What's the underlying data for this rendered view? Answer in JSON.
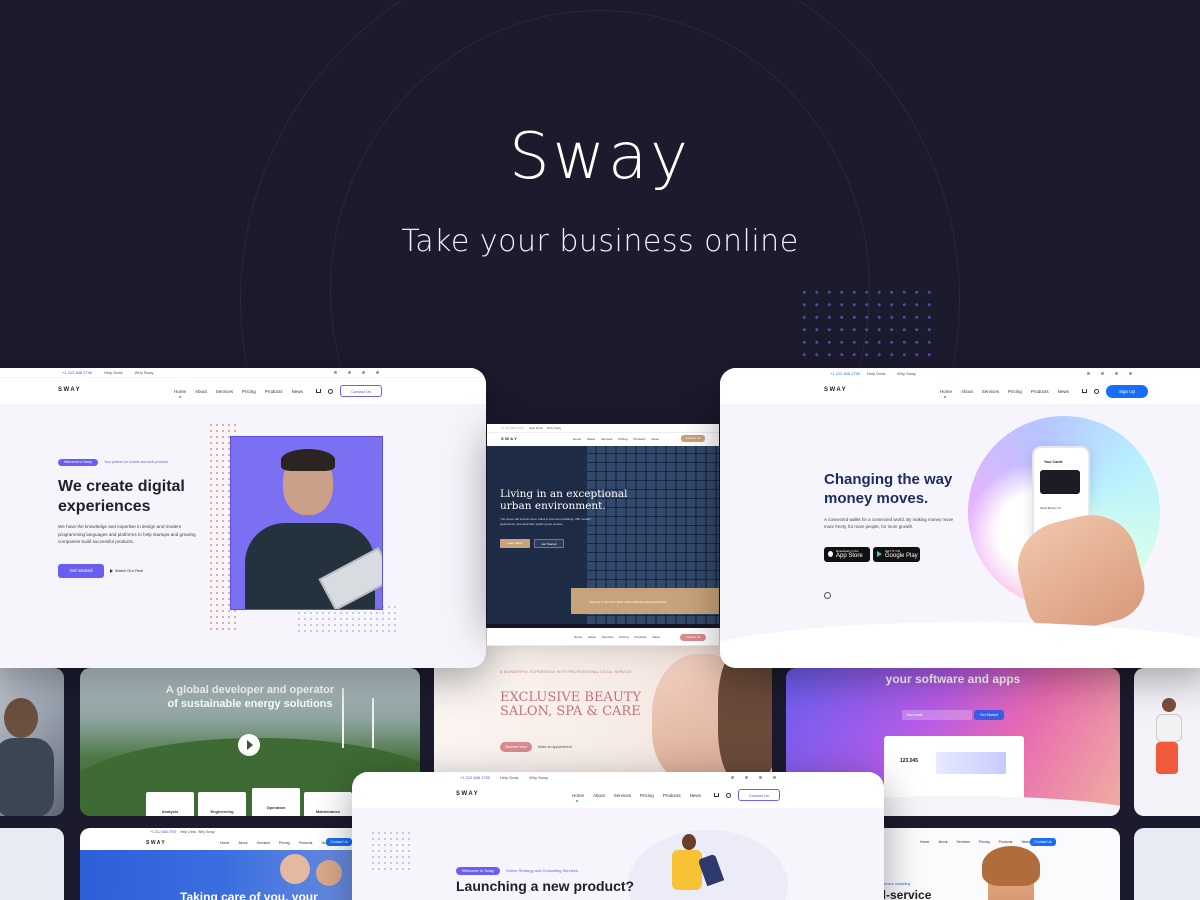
{
  "hero": {
    "title": "Sway",
    "subtitle": "Take your business online"
  },
  "colors": {
    "background": "#1c1b2e",
    "accent": "#6a5ef0",
    "blue": "#1a6df5",
    "gold": "#c8a27a",
    "pink": "#d98b8f"
  },
  "card_main": {
    "topbar": {
      "phone": "+1 212 846 2700",
      "help": "Help Desk",
      "why": "Why Sway"
    },
    "logo": "SWAY",
    "nav": [
      "Home",
      "About",
      "Services",
      "Pricing",
      "Products",
      "News"
    ],
    "contact": "Contact Us",
    "badge": "Welcome to Sway",
    "badge_note": "Your partner for mobile and web products",
    "headline_1": "We create digital",
    "headline_2": "experiences",
    "body": "We have the knowledge and expertise in design and modern programming languages and platforms to help startups and growing companies build successful products.",
    "cta": "Get Started",
    "video": "Watch Our Reel"
  },
  "card_realestate": {
    "topbar": {
      "phone": "+1 212 846 2700",
      "help": "Help Desk",
      "why": "Why Sway"
    },
    "logo": "SWAY",
    "nav": [
      "Home",
      "About",
      "Services",
      "Pricing",
      "Products",
      "News"
    ],
    "contact": "Contact Us",
    "headline_1": "Living in an exceptional",
    "headline_2": "urban environment.",
    "body": "The space will include three Class A luxurious buildings, 300 modern apartments, and abundant public green spaces.",
    "btn1": "Learn More",
    "btn2": "Get Started",
    "footer": "Opening in Summer 2021 | Show Building Now Sell Phase"
  },
  "card_fintech": {
    "topbar": {
      "phone": "+1 212 846 2700",
      "help": "Help Desk",
      "why": "Why Sway"
    },
    "logo": "SWAY",
    "nav": [
      "Home",
      "About",
      "Services",
      "Pricing",
      "Products",
      "News"
    ],
    "signup": "Sign Up",
    "headline_1": "Changing the way",
    "headline_2": "money moves.",
    "body": "A connected wallet for a connected world. By making money move more freely, for more people, for more growth.",
    "appstore_small": "Download on the",
    "appstore": "App Store",
    "gplay_small": "GET IT ON",
    "gplay": "Google Play",
    "phone_screen": {
      "title": "Your Cards",
      "section": "Send Money To",
      "rows": [
        "Change Profile",
        "Bank Card",
        "Contact Relation"
      ]
    }
  },
  "tile_energy": {
    "headline_1": "A global developer and operator",
    "headline_2": "of sustainable energy solutions",
    "labels": [
      "Analysis",
      "Engineering",
      "Operation",
      "Maintenance"
    ]
  },
  "tile_beauty": {
    "eyebrow": "A WONDERFUL EXPERIENCE WITH PROFESSIONAL LOCAL SERVICE",
    "headline_1": "EXCLUSIVE BEAUTY",
    "headline_2": "SALON, SPA & CARE",
    "btn": "Discover More",
    "link": "Make an Appointment",
    "nav": [
      "Home",
      "About",
      "Services",
      "Pricing",
      "Products",
      "News"
    ],
    "contact": "Contact Us"
  },
  "tile_software": {
    "headline": "your software and apps",
    "btn": "Get Started",
    "input_placeholder": "Your email",
    "stat": "123,045"
  },
  "tile_family": {
    "logo": "SWAY",
    "phone": "+1 212 846 2700",
    "help": "Help Desk",
    "why": "Why Sway",
    "nav": [
      "Home",
      "About",
      "Services",
      "Pricing",
      "Products",
      "News"
    ],
    "contact": "Contact Us",
    "headline": "Taking care of you, your"
  },
  "tile_fullservice": {
    "eyebrow": "Full-service marketing",
    "headline": "ull-service",
    "nav": [
      "Home",
      "About",
      "Services",
      "Pricing",
      "Products",
      "News"
    ],
    "contact": "Contact Us"
  },
  "card_product": {
    "topbar": {
      "phone": "+1 212 846 2700",
      "help": "Help Desk",
      "why": "Why Sway"
    },
    "logo": "SWAY",
    "nav": [
      "Home",
      "About",
      "Services",
      "Pricing",
      "Products",
      "News"
    ],
    "contact": "Contact Us",
    "badge": "Welcome to Sway",
    "badge_note": "Online Strategy and Consulting Services",
    "headline": "Launching a new product?"
  }
}
